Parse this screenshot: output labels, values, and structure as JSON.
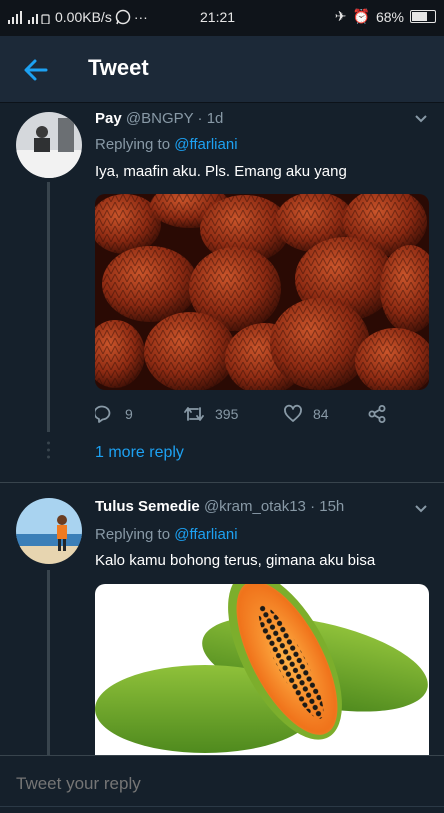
{
  "status_bar": {
    "network_speed": "0.00KB/s",
    "time": "21:21",
    "battery": "68%"
  },
  "header": {
    "title": "Tweet"
  },
  "tweets": [
    {
      "name": "Pay",
      "handle": "@BNGPY",
      "time": "1d",
      "replying_prefix": "Replying to",
      "replying_to": "@ffarliani",
      "text": "Iya, maafin aku. Pls. Emang aku yang",
      "replies": "9",
      "retweets": "395",
      "likes": "84",
      "more_replies": "1 more reply"
    },
    {
      "name": "Tulus Semedie",
      "handle": "@kram_otak13",
      "time": "15h",
      "replying_prefix": "Replying to",
      "replying_to": "@ffarliani",
      "text": "Kalo kamu bohong terus, gimana aku bisa"
    }
  ],
  "composer": {
    "placeholder": "Tweet your reply"
  },
  "colors": {
    "background": "#15202b",
    "accent": "#1da1f2",
    "muted": "#8899a6"
  }
}
